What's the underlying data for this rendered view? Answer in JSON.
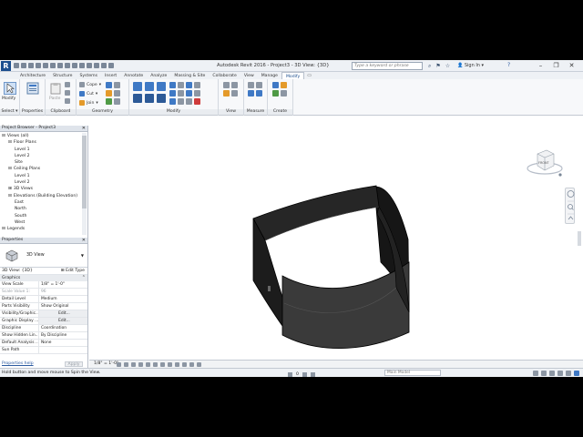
{
  "window": {
    "app_letter": "R",
    "title": "Autodesk Revit 2016 -    Project3 - 3D View: {3D}",
    "search_placeholder": "Type a keyword or phrase",
    "sign_in": "Sign In",
    "help_icon": "?"
  },
  "ribbon": {
    "tabs": [
      "Architecture",
      "Structure",
      "Systems",
      "Insert",
      "Annotate",
      "Analyze",
      "Massing & Site",
      "Collaborate",
      "View",
      "Manage",
      "Modify"
    ],
    "active_tab": "Modify",
    "select_label": "Select",
    "modify_button": "Modify",
    "properties_label": "Properties",
    "clipboard_label": "Clipboard",
    "paste_label": "Paste",
    "geometry_label": "Geometry",
    "cope_label": "Cope",
    "cut_label": "Cut",
    "join_label": "Join",
    "modify_panel_label": "Modify",
    "view_panel_label": "View",
    "measure_panel_label": "Measure",
    "create_panel_label": "Create"
  },
  "project_browser": {
    "title": "Project Browser - Project3",
    "items": [
      {
        "text": "Views (all)",
        "level": 0,
        "toggle": "⊟"
      },
      {
        "text": "Floor Plans",
        "level": 1,
        "toggle": "⊟"
      },
      {
        "text": "Level 1",
        "level": 2,
        "toggle": ""
      },
      {
        "text": "Level 2",
        "level": 2,
        "toggle": ""
      },
      {
        "text": "Site",
        "level": 2,
        "toggle": ""
      },
      {
        "text": "Ceiling Plans",
        "level": 1,
        "toggle": "⊟"
      },
      {
        "text": "Level 1",
        "level": 2,
        "toggle": ""
      },
      {
        "text": "Level 2",
        "level": 2,
        "toggle": ""
      },
      {
        "text": "3D Views",
        "level": 1,
        "toggle": "⊞"
      },
      {
        "text": "Elevations (Building Elevation)",
        "level": 1,
        "toggle": "⊟"
      },
      {
        "text": "East",
        "level": 2,
        "toggle": ""
      },
      {
        "text": "North",
        "level": 2,
        "toggle": ""
      },
      {
        "text": "South",
        "level": 2,
        "toggle": ""
      },
      {
        "text": "West",
        "level": 2,
        "toggle": ""
      },
      {
        "text": "Legends",
        "level": 0,
        "toggle": "⊟"
      }
    ]
  },
  "properties": {
    "title": "Properties",
    "type_name": "3D View",
    "instance": "3D View: {3D}",
    "edit_type": "Edit Type",
    "category": "Graphics",
    "rows": [
      {
        "key": "View Scale",
        "value": "1/8\" = 1'-0\"",
        "dim": false,
        "button": false
      },
      {
        "key": "Scale Value    1:",
        "value": "96",
        "dim": true,
        "button": false
      },
      {
        "key": "Detail Level",
        "value": "Medium",
        "dim": false,
        "button": false
      },
      {
        "key": "Parts Visibility",
        "value": "Show Original",
        "dim": false,
        "button": false
      },
      {
        "key": "Visibility/Graphic...",
        "value": "Edit...",
        "dim": false,
        "button": true
      },
      {
        "key": "Graphic Display ...",
        "value": "Edit...",
        "dim": false,
        "button": true
      },
      {
        "key": "Discipline",
        "value": "Coordination",
        "dim": false,
        "button": false
      },
      {
        "key": "Show Hidden Lin...",
        "value": "By Discipline",
        "dim": false,
        "button": false
      },
      {
        "key": "Default Analysis ...",
        "value": "None",
        "dim": false,
        "button": false
      },
      {
        "key": "Sun Path",
        "value": "",
        "dim": false,
        "button": false
      }
    ],
    "help_link": "Properties help",
    "apply": "Apply"
  },
  "viewport": {
    "viewcube_face": "FRONT"
  },
  "view_control": {
    "scale": "1/8\" = 1'-0\""
  },
  "status": {
    "text": "Hold button and move mouse to Spin the View.",
    "model_field": "Main Model",
    "zero": "0"
  }
}
